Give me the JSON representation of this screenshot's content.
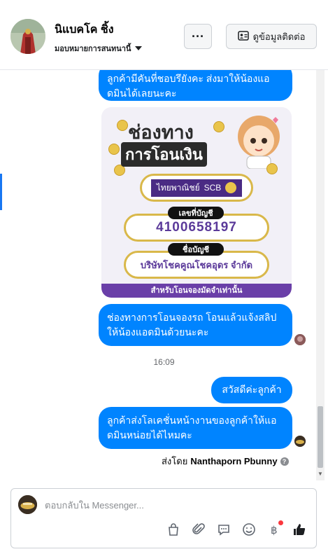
{
  "header": {
    "contact_name": "นิแบคโค ชิ้ง",
    "assign_label": "มอบหมายการสนทนานี้",
    "more_label": "···",
    "info_button_label": "ดูข้อมูลติดต่อ"
  },
  "messages": {
    "m1": "ลูกค้ามีคันที่ชอบรึยังคะ ส่งมาให้น้องแอดมินได้เลยนะคะ",
    "m2": "ช่องทางการโอนจองรถ โอนแล้วแจ้งสลิปให้น้องแอดมินด้วยนะคะ",
    "timestamp": "16:09",
    "m3": "สวัสดีค่ะลูกค้า",
    "m4": "ลูกค้าส่งโลเคชั่นหน้างานของลูกค้าให้แอดมินหน่อยได้ไหมคะ",
    "sent_by_prefix": "ส่งโดย",
    "sent_by_name": "Nanthaporn Pbunny",
    "help_glyph": "?"
  },
  "transfer_card": {
    "title_line1": "ช่องทาง",
    "title_line2": "การโอนเงิน",
    "bank_name": "ไทยพาณิชย์",
    "bank_code": "SCB",
    "account_number_label": "เลขที่บัญชี",
    "account_number": "4100658197",
    "account_name_label": "ชื่อบัญชี",
    "account_name": "บริษัทโชคคูณโชคอุดร จำกัด",
    "footer": "สำหรับโอนจองมัดจำเท่านั้น"
  },
  "composer": {
    "placeholder": "ตอบกลับใน Messenger..."
  },
  "colors": {
    "bubble": "#0084ff",
    "card_purple": "#6a3fa8",
    "like": "#1c1e21"
  },
  "icons": [
    "shopping-bag-icon",
    "paperclip-icon",
    "chat-bubble-icon",
    "emoji-icon",
    "baht-icon",
    "thumbs-up-icon"
  ]
}
